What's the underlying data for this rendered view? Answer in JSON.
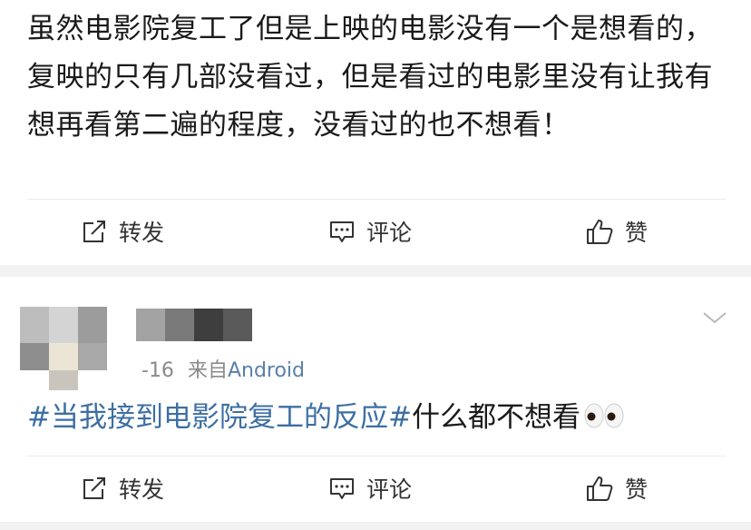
{
  "post1": {
    "text": "虽然电影院复工了但是上映的电影没有一个是想看的，复映的只有几部没看过，但是看过的电影里没有让我有想再看第二遍的程度，没看过的也不想看！"
  },
  "post2": {
    "time": "-16",
    "source_prefix": "来自",
    "source": "Android",
    "topic": "#当我接到电影院复工的反应#",
    "text": "什么都不想看"
  },
  "actions": {
    "repost": "转发",
    "comment": "评论",
    "like": "赞"
  },
  "icons": [
    "repost-icon",
    "comment-icon",
    "like-icon",
    "chevron-down-icon",
    "eyes-emoji-icon"
  ],
  "colors": {
    "topic_link": "#3d6fa3",
    "source_link": "#5a7fa8",
    "meta_gray": "#8a8a8a",
    "separator_bg": "#f2f2f2"
  }
}
